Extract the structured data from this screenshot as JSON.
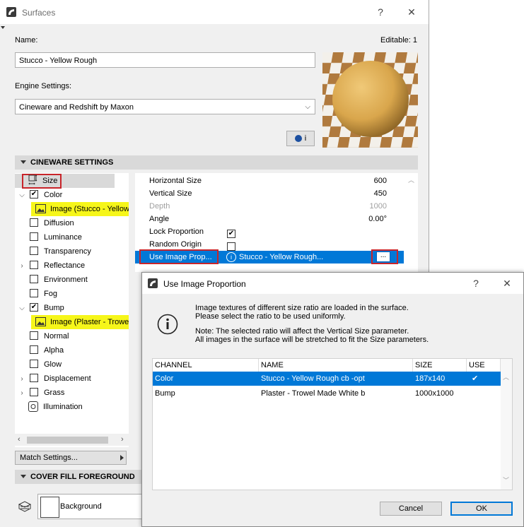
{
  "surfaces": {
    "title": "Surfaces",
    "help": "?",
    "close": "✕",
    "name_label": "Name:",
    "editable_label": "Editable: 1",
    "name_value": "Stucco - Yellow Rough",
    "engine_label": "Engine Settings:",
    "engine_value": "Cineware and Redshift by Maxon",
    "info_button": "i",
    "cineware_header": "CINEWARE SETTINGS",
    "cover_fill_header": "COVER FILL FOREGROUND",
    "match_settings": "Match Settings...",
    "background_label": "Background",
    "channels": {
      "size": "Size",
      "color": "Color",
      "color_image": "Image (Stucco - Yellow",
      "diffusion": "Diffusion",
      "luminance": "Luminance",
      "transparency": "Transparency",
      "reflectance": "Reflectance",
      "environment": "Environment",
      "fog": "Fog",
      "bump": "Bump",
      "bump_image": "Image (Plaster - Trowe",
      "normal": "Normal",
      "alpha": "Alpha",
      "glow": "Glow",
      "displacement": "Displacement",
      "grass": "Grass",
      "illumination": "Illumination"
    },
    "props": {
      "hsize_label": "Horizontal Size",
      "hsize_value": "600",
      "vsize_label": "Vertical Size",
      "vsize_value": "450",
      "depth_label": "Depth",
      "depth_value": "1000",
      "angle_label": "Angle",
      "angle_value": "0.00°",
      "lock_label": "Lock Proportion",
      "random_label": "Random Origin",
      "use_image_label": "Use Image Prop...",
      "use_image_value": "Stucco - Yellow Rough...",
      "browse_button": "..."
    },
    "check_mark": "✔"
  },
  "dialog": {
    "title": "Use Image Proportion",
    "help": "?",
    "close": "✕",
    "message_1": "Image textures of different size ratio are loaded in the surface.",
    "message_2": "Please select the ratio to be used uniformly.",
    "note_1": "Note: The selected ratio will affect the Vertical Size parameter.",
    "note_2": "All images in the surface will be stretched to fit the Size parameters.",
    "columns": [
      "CHANNEL",
      "NAME",
      "SIZE",
      "USE"
    ],
    "rows": [
      {
        "channel": "Color",
        "name": "Stucco - Yellow Rough cb -opt",
        "size": "187x140",
        "use": "✔"
      },
      {
        "channel": "Bump",
        "name": "Plaster - Trowel Made White b",
        "size": "1000x1000",
        "use": ""
      }
    ],
    "cancel": "Cancel",
    "ok": "OK"
  },
  "colors": {
    "selection": "#0078d7",
    "highlight": "#f6f61a",
    "annotation_red": "#c8242a"
  }
}
